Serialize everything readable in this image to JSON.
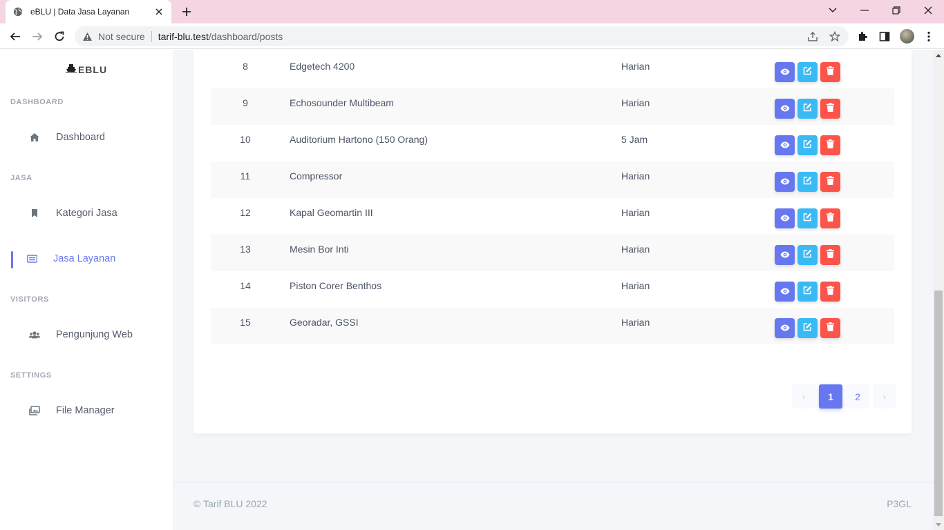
{
  "browser": {
    "tab_title": "eBLU | Data Jasa Layanan",
    "omnibox_security": "Not secure",
    "url_host": "tarif-blu.test",
    "url_path": "/dashboard/posts"
  },
  "sidebar": {
    "brand": "EBLU",
    "sections": [
      {
        "heading": "DASHBOARD",
        "items": [
          {
            "label": "Dashboard",
            "icon": "home-icon"
          }
        ]
      },
      {
        "heading": "JASA",
        "items": [
          {
            "label": "Kategori Jasa",
            "icon": "bookmark-icon"
          },
          {
            "label": "Jasa Layanan",
            "icon": "list-icon",
            "active": true
          }
        ]
      },
      {
        "heading": "VISITORS",
        "items": [
          {
            "label": "Pengunjung Web",
            "icon": "users-icon"
          }
        ]
      },
      {
        "heading": "SETTINGS",
        "items": [
          {
            "label": "File Manager",
            "icon": "images-icon"
          }
        ]
      }
    ]
  },
  "table": {
    "rows": [
      {
        "no": "8",
        "name": "Edgetech 4200",
        "unit": "Harian"
      },
      {
        "no": "9",
        "name": "Echosounder Multibeam",
        "unit": "Harian"
      },
      {
        "no": "10",
        "name": "Auditorium Hartono (150 Orang)",
        "unit": "5 Jam"
      },
      {
        "no": "11",
        "name": "Compressor",
        "unit": "Harian"
      },
      {
        "no": "12",
        "name": "Kapal Geomartin III",
        "unit": "Harian"
      },
      {
        "no": "13",
        "name": "Mesin Bor Inti",
        "unit": "Harian"
      },
      {
        "no": "14",
        "name": "Piston Corer Benthos",
        "unit": "Harian"
      },
      {
        "no": "15",
        "name": "Georadar, GSSI",
        "unit": "Harian"
      }
    ]
  },
  "pagination": {
    "prev": "‹",
    "pages": [
      "1",
      "2"
    ],
    "current": "1",
    "next": "›"
  },
  "footer": {
    "copyright": "© Tarif BLU 2022",
    "right": "P3GL"
  },
  "colors": {
    "primary": "#6777ef",
    "info": "#3abaf4",
    "danger": "#fc544b",
    "tabbar": "#f5d5e3"
  }
}
